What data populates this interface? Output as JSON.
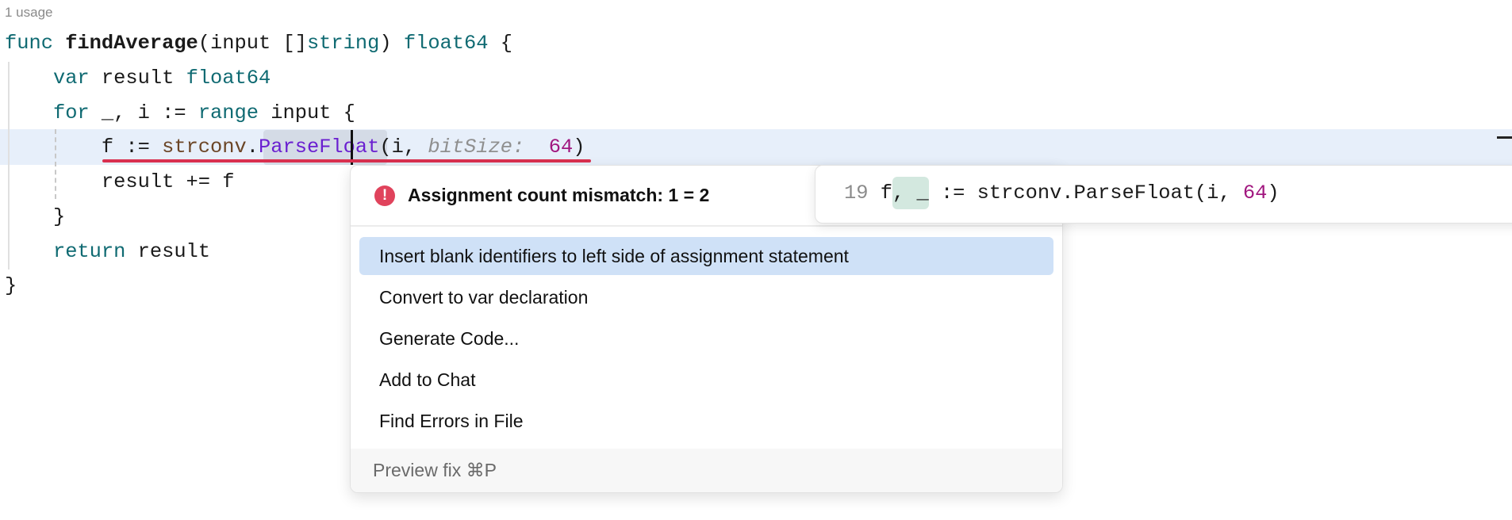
{
  "editor": {
    "usage_hint": "1 usage",
    "lines": [
      [
        [
          "func ",
          "kw"
        ],
        [
          "findAverage",
          "bold"
        ],
        [
          "(input []",
          ""
        ],
        [
          "string",
          "kw"
        ],
        [
          ") ",
          ""
        ],
        [
          "float64",
          "kw"
        ],
        [
          " {",
          ""
        ]
      ],
      [
        [
          "    ",
          ""
        ],
        [
          "var",
          "kw"
        ],
        [
          " result ",
          ""
        ],
        [
          "float64",
          "kw"
        ]
      ],
      [
        [
          "    ",
          ""
        ],
        [
          "for",
          "kw"
        ],
        [
          " _, i := ",
          ""
        ],
        [
          "range",
          "kw"
        ],
        [
          " input {",
          ""
        ]
      ],
      [
        [
          "        f := ",
          ""
        ],
        [
          "strconv",
          "pkg"
        ],
        [
          ".",
          ""
        ],
        [
          "ParseFloat",
          "fn"
        ],
        [
          "(i, ",
          ""
        ],
        [
          "bitSize:",
          "hint"
        ],
        [
          "  ",
          ""
        ],
        [
          "64",
          "num"
        ],
        [
          ")",
          ""
        ]
      ],
      [
        [
          "        result += f",
          ""
        ]
      ],
      [
        [
          "    }",
          ""
        ]
      ],
      [
        [
          "    ",
          ""
        ],
        [
          "return",
          "kw"
        ],
        [
          " result",
          ""
        ]
      ],
      [
        [
          "}",
          ""
        ]
      ]
    ]
  },
  "popup": {
    "error_message": "Assignment count mismatch: 1 = 2",
    "items": [
      {
        "label": "Insert blank identifiers to left side of assignment statement",
        "selected": true
      },
      {
        "label": "Convert to var declaration"
      },
      {
        "label": "Generate Code..."
      },
      {
        "label": "Add to Chat"
      },
      {
        "label": "Find Errors in File"
      }
    ],
    "footer": "Preview fix ⌘P"
  },
  "preview": {
    "line_number": "19",
    "before": "f",
    "inserted": ", _",
    "after_1": " := strconv.ParseFloat(i, ",
    "number": "64",
    "after_2": ")"
  }
}
